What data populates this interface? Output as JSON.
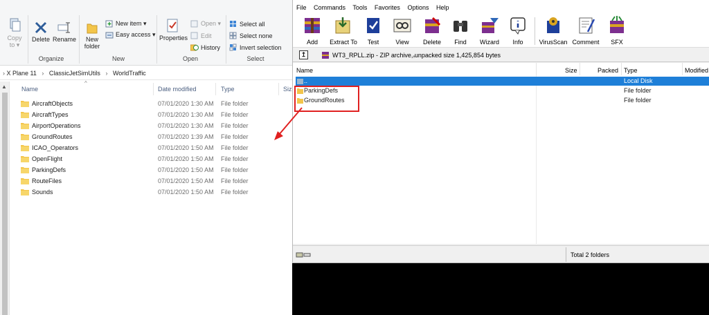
{
  "explorer": {
    "ribbon": {
      "clipboard": {
        "copy_label": "Copy",
        "copy_to_label": "to ▾"
      },
      "organize": {
        "delete_label": "Delete",
        "rename_label": "Rename",
        "group_label": "Organize"
      },
      "new": {
        "new_folder_line1": "New",
        "new_folder_line2": "folder",
        "new_item_label": "New item ▾",
        "easy_access_label": "Easy access ▾",
        "group_label": "New"
      },
      "open": {
        "properties_label": "Properties",
        "open_label": "Open ▾",
        "edit_label": "Edit",
        "history_label": "History",
        "group_label": "Open"
      },
      "select": {
        "select_all_label": "Select all",
        "select_none_label": "Select none",
        "invert_label": "Invert selection",
        "group_label": "Select"
      }
    },
    "breadcrumb": [
      "X Plane 11",
      "ClassicJetSimUtils",
      "WorldTraffic"
    ],
    "breadcrumb_sep": "›",
    "columns": {
      "name": "Name",
      "date": "Date modified",
      "type": "Type",
      "size": "Siz"
    },
    "sort_indicator": "^",
    "files": [
      {
        "name": "AircraftObjects",
        "date": "07/01/2020 1:30 AM",
        "type": "File folder"
      },
      {
        "name": "AircraftTypes",
        "date": "07/01/2020 1:30 AM",
        "type": "File folder"
      },
      {
        "name": "AirportOperations",
        "date": "07/01/2020 1:30 AM",
        "type": "File folder"
      },
      {
        "name": "GroundRoutes",
        "date": "07/01/2020 1:39 AM",
        "type": "File folder"
      },
      {
        "name": "ICAO_Operators",
        "date": "07/01/2020 1:50 AM",
        "type": "File folder"
      },
      {
        "name": "OpenFlight",
        "date": "07/01/2020 1:50 AM",
        "type": "File folder"
      },
      {
        "name": "ParkingDefs",
        "date": "07/01/2020 1:50 AM",
        "type": "File folder"
      },
      {
        "name": "RouteFiles",
        "date": "07/01/2020 1:50 AM",
        "type": "File folder"
      },
      {
        "name": "Sounds",
        "date": "07/01/2020 1:50 AM",
        "type": "File folder"
      }
    ]
  },
  "winrar": {
    "menu": [
      "File",
      "Commands",
      "Tools",
      "Favorites",
      "Options",
      "Help"
    ],
    "toolbar": [
      {
        "label": "Add",
        "icon": "add-icon"
      },
      {
        "label": "Extract To",
        "icon": "extract-icon"
      },
      {
        "label": "Test",
        "icon": "test-icon"
      },
      {
        "label": "View",
        "icon": "view-icon"
      },
      {
        "label": "Delete",
        "icon": "delete-icon"
      },
      {
        "label": "Find",
        "icon": "find-icon"
      },
      {
        "label": "Wizard",
        "icon": "wizard-icon"
      },
      {
        "label": "Info",
        "icon": "info-icon"
      },
      {
        "label": "VirusScan",
        "icon": "virusscan-icon"
      },
      {
        "label": "Comment",
        "icon": "comment-icon"
      },
      {
        "label": "SFX",
        "icon": "sfx-icon"
      }
    ],
    "path_text": "WT3_RPLL.zip - ZIP archive, unpacked size 1,425,854 bytes",
    "columns": {
      "name": "Name",
      "size": "Size",
      "packed": "Packed",
      "type": "Type",
      "modified": "Modified"
    },
    "rows": [
      {
        "name": "..",
        "type": "Local Disk",
        "selected": true
      },
      {
        "name": "ParkingDefs",
        "type": "File folder",
        "selected": false
      },
      {
        "name": "GroundRoutes",
        "type": "File folder",
        "selected": false
      }
    ],
    "status_text": "Total 2 folders"
  },
  "colors": {
    "annotation": "#e02020",
    "selection": "#1e7fd8",
    "folder": "#f3c54a"
  }
}
